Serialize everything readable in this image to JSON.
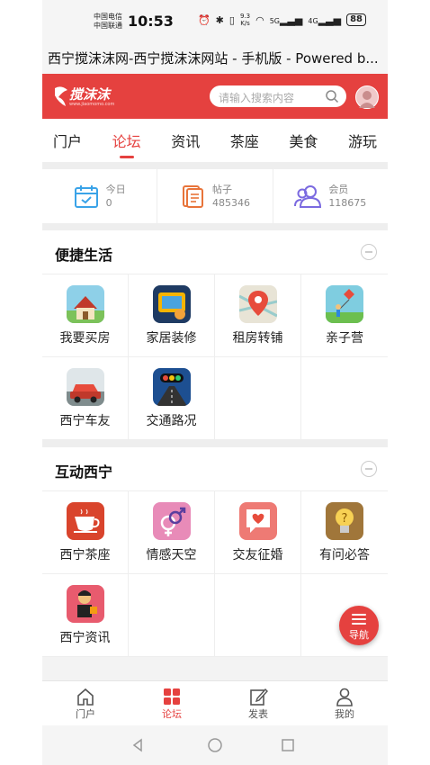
{
  "status": {
    "carrier1": "中国电信",
    "carrier2": "中国联通",
    "time": "10:53",
    "speed_top": "9.3",
    "speed_bottom": "K/s",
    "signal1": "5G",
    "signal2": "4G",
    "battery": "88"
  },
  "page_title": "西宁搅沫沫网-西宁搅沫沫网站 - 手机版 - Powered b...",
  "header": {
    "logo_text": "搅沫沫",
    "logo_sub": "www.jiaomomo.com",
    "search_placeholder": "请输入搜索内容"
  },
  "tabs": [
    "门户",
    "论坛",
    "资讯",
    "茶座",
    "美食",
    "游玩"
  ],
  "active_tab": "论坛",
  "stats": [
    {
      "label": "今日",
      "value": "0",
      "icon": "calendar-icon"
    },
    {
      "label": "帖子",
      "value": "485346",
      "icon": "document-icon"
    },
    {
      "label": "会员",
      "value": "118675",
      "icon": "members-icon"
    }
  ],
  "section1": {
    "title": "便捷生活",
    "items": [
      {
        "label": "我要买房",
        "icon": "house-icon"
      },
      {
        "label": "家居装修",
        "icon": "sofa-icon"
      },
      {
        "label": "租房转铺",
        "icon": "map-pin-icon"
      },
      {
        "label": "亲子营",
        "icon": "kite-icon"
      },
      {
        "label": "西宁车友",
        "icon": "car-icon"
      },
      {
        "label": "交通路况",
        "icon": "traffic-light-icon"
      }
    ]
  },
  "section2": {
    "title": "互动西宁",
    "items": [
      {
        "label": "西宁茶座",
        "icon": "tea-cup-icon"
      },
      {
        "label": "情感天空",
        "icon": "gender-icon"
      },
      {
        "label": "交友征婚",
        "icon": "heart-chat-icon"
      },
      {
        "label": "有问必答",
        "icon": "lightbulb-icon"
      },
      {
        "label": "西宁资讯",
        "icon": "reporter-icon"
      }
    ]
  },
  "fab_label": "导航",
  "bottom_nav": [
    {
      "label": "门户",
      "icon": "home-icon"
    },
    {
      "label": "论坛",
      "icon": "grid-icon"
    },
    {
      "label": "发表",
      "icon": "edit-icon"
    },
    {
      "label": "我的",
      "icon": "user-icon"
    }
  ],
  "colors": {
    "brand": "#e5413f",
    "text": "#222222",
    "muted": "#888888"
  }
}
